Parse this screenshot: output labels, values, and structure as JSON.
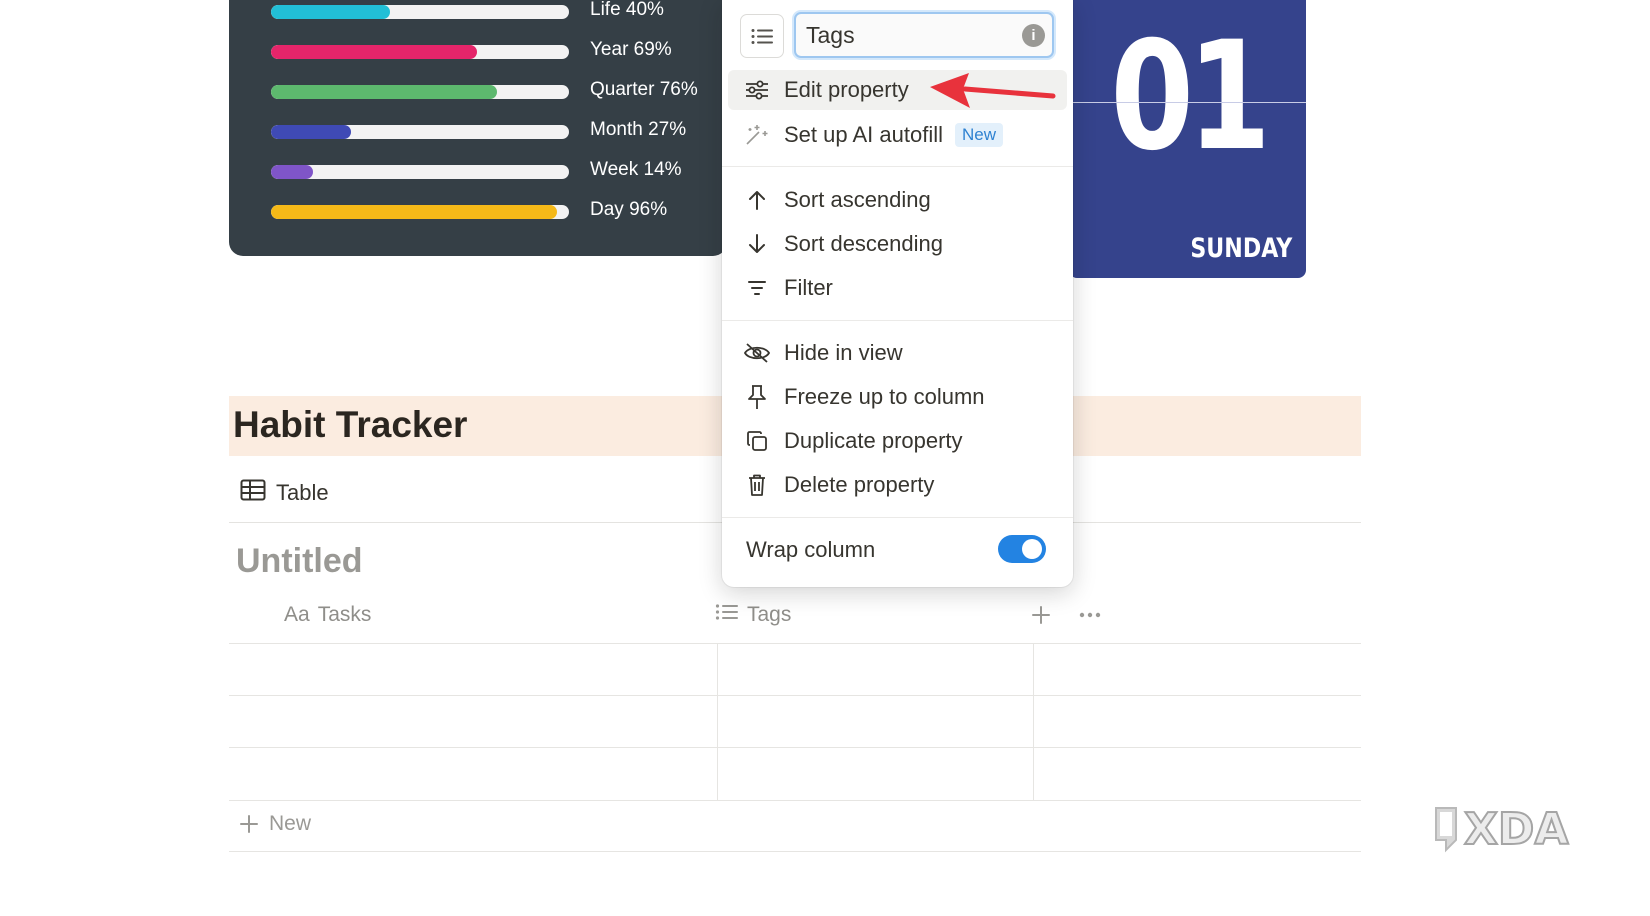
{
  "progress": {
    "rows": [
      {
        "label": "Life 40%",
        "value": 0.4,
        "color": "#22bfd7"
      },
      {
        "label": "Year 69%",
        "value": 0.69,
        "color": "#e5256a"
      },
      {
        "label": "Quarter 76%",
        "value": 0.76,
        "color": "#5db96e"
      },
      {
        "label": "Month 27%",
        "value": 0.27,
        "color": "#3f4ab5"
      },
      {
        "label": "Week 14%",
        "value": 0.14,
        "color": "#7f55c8"
      },
      {
        "label": "Day 96%",
        "value": 0.96,
        "color": "#f5b918"
      }
    ]
  },
  "calendar": {
    "date": "01",
    "day": "SUNDAY",
    "color": "#35438c"
  },
  "habit": {
    "title": "Habit Tracker",
    "view_tab": "Table",
    "db_title": "Untitled",
    "columns": [
      {
        "icon_text": "Aa",
        "label": "Tasks"
      },
      {
        "label": "Tags"
      }
    ],
    "new_row": "New"
  },
  "menu": {
    "property_name_value": "Tags",
    "info_glyph": "i",
    "items": {
      "edit_property": "Edit property",
      "ai_autofill": "Set up AI autofill",
      "ai_autofill_badge": "New",
      "sort_ascending": "Sort ascending",
      "sort_descending": "Sort descending",
      "filter": "Filter",
      "hide_in_view": "Hide in view",
      "freeze": "Freeze up to column",
      "duplicate": "Duplicate property",
      "delete": "Delete property"
    },
    "wrap_column": "Wrap column",
    "wrap_enabled": true
  },
  "watermark": {
    "text": "XDA"
  },
  "colors": {
    "accent": "#2383e2",
    "annotation_arrow": "#e8323c",
    "banner": "#fbece0"
  }
}
